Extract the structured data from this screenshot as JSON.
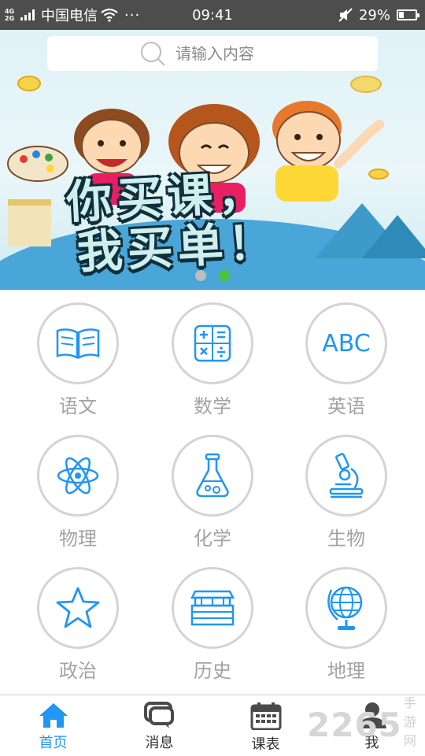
{
  "status_bar": {
    "network": "4G\n2G",
    "carrier": "中国电信",
    "more": "···",
    "time": "09:41",
    "battery": "29%",
    "battery_level": 0.29,
    "icons": [
      "signal-icon",
      "wifi-icon",
      "mute-icon",
      "battery-icon"
    ]
  },
  "search": {
    "placeholder": "请输入内容"
  },
  "banner": {
    "slogan_line1": "你买课，",
    "slogan_line2": "我买单！",
    "active_slide": 2,
    "slide_count": 2
  },
  "subjects": [
    {
      "label": "语文",
      "icon": "book-icon"
    },
    {
      "label": "数学",
      "icon": "calculator-icon"
    },
    {
      "label": "英语",
      "icon": "abc-icon",
      "icon_text": "ABC"
    },
    {
      "label": "物理",
      "icon": "atom-icon"
    },
    {
      "label": "化学",
      "icon": "flask-icon"
    },
    {
      "label": "生物",
      "icon": "microscope-icon"
    },
    {
      "label": "政治",
      "icon": "star-icon"
    },
    {
      "label": "历史",
      "icon": "temple-icon"
    },
    {
      "label": "地理",
      "icon": "globe-icon"
    }
  ],
  "nav": {
    "items": [
      {
        "label": "首页",
        "icon": "home-icon",
        "active": true
      },
      {
        "label": "消息",
        "icon": "message-icon",
        "active": false
      },
      {
        "label": "课表",
        "icon": "calendar-icon",
        "active": false
      },
      {
        "label": "我",
        "icon": "user-icon",
        "active": false
      }
    ]
  },
  "watermark": {
    "number": "2265",
    "text": "手游网"
  },
  "colors": {
    "accent": "#2196f3",
    "status_bar": "#4d4d4d",
    "label_gray": "#a3a3a3",
    "dot_active": "#4cc43a"
  }
}
